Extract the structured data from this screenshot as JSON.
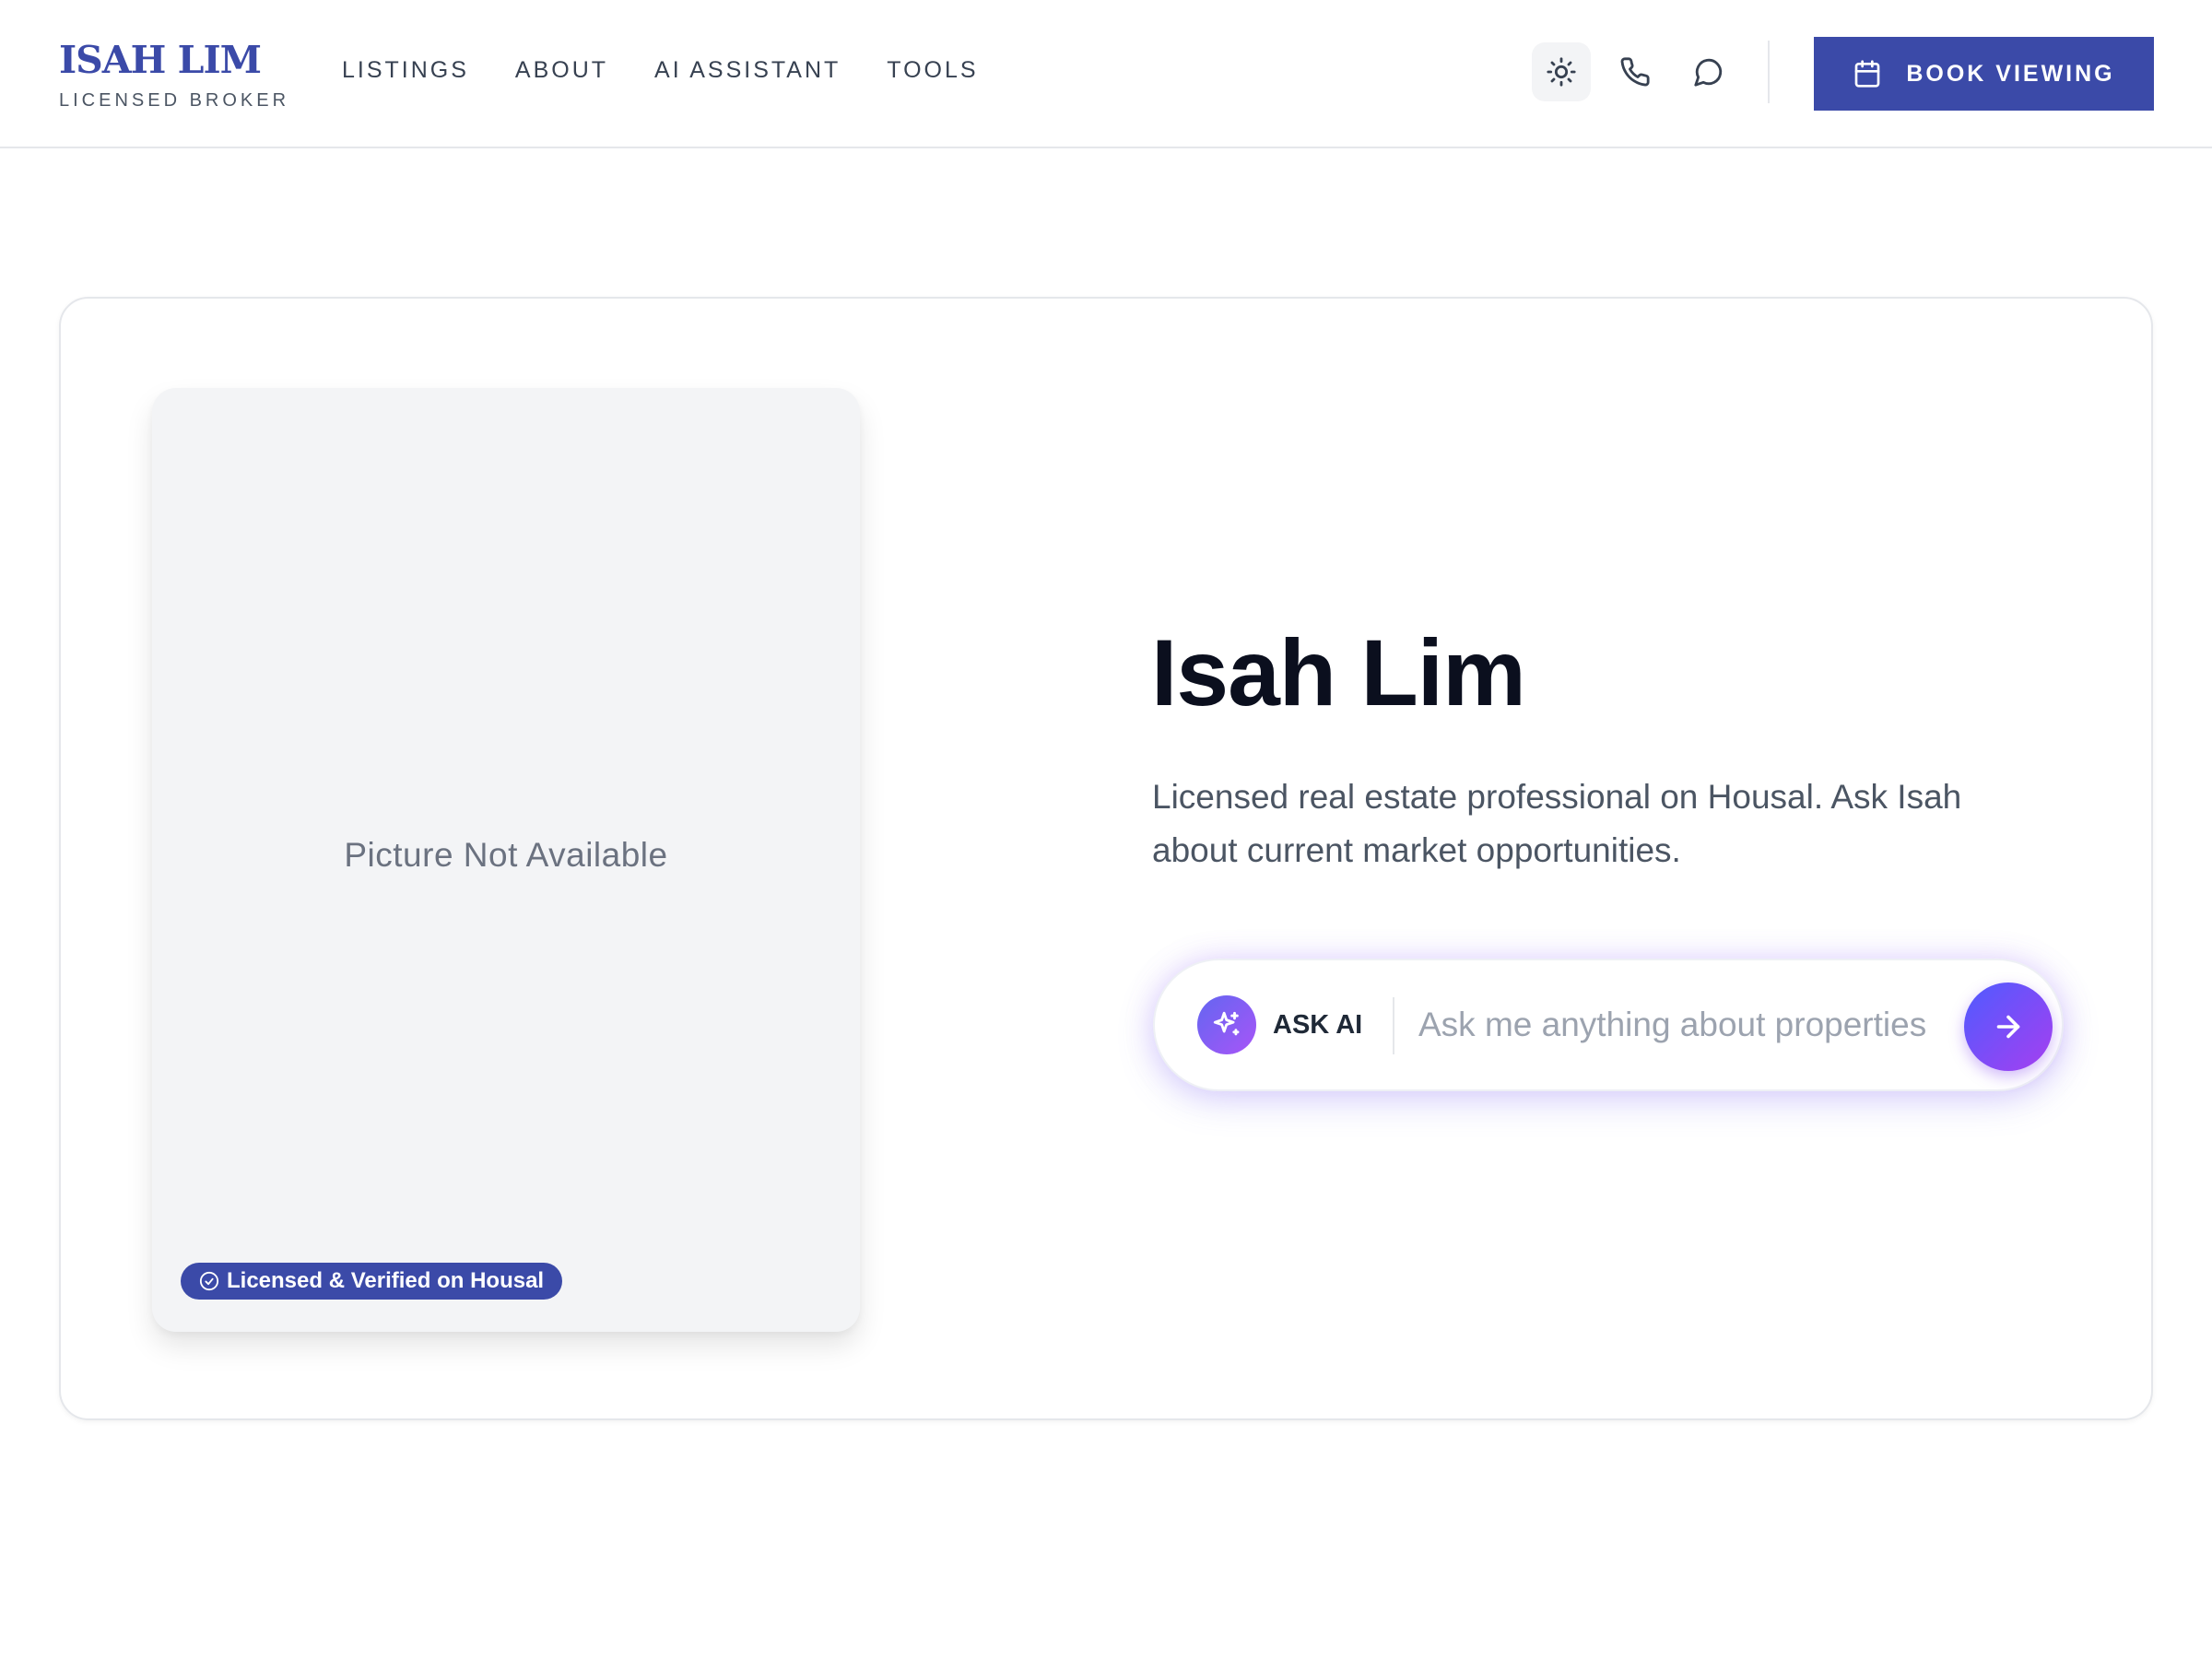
{
  "header": {
    "brand_name": "ISAH LIM",
    "brand_subtitle": "LICENSED BROKER",
    "nav": [
      {
        "label": "LISTINGS"
      },
      {
        "label": "ABOUT"
      },
      {
        "label": "AI ASSISTANT"
      },
      {
        "label": "TOOLS"
      }
    ],
    "icons": [
      "sun-icon",
      "phone-icon",
      "chat-icon"
    ],
    "book_label": "BOOK VIEWING"
  },
  "profile": {
    "photo_placeholder": "Picture Not Available",
    "verified_badge": "Licensed & Verified on Housal",
    "name": "Isah Lim",
    "description": "Licensed real estate professional on Housal. Ask Isah about current market opportunities."
  },
  "ask": {
    "label": "ASK AI",
    "placeholder": "Ask me anything about properties"
  },
  "colors": {
    "brand": "#3b4aa8",
    "gradient_start": "#6366f1",
    "gradient_end": "#a855f7"
  }
}
